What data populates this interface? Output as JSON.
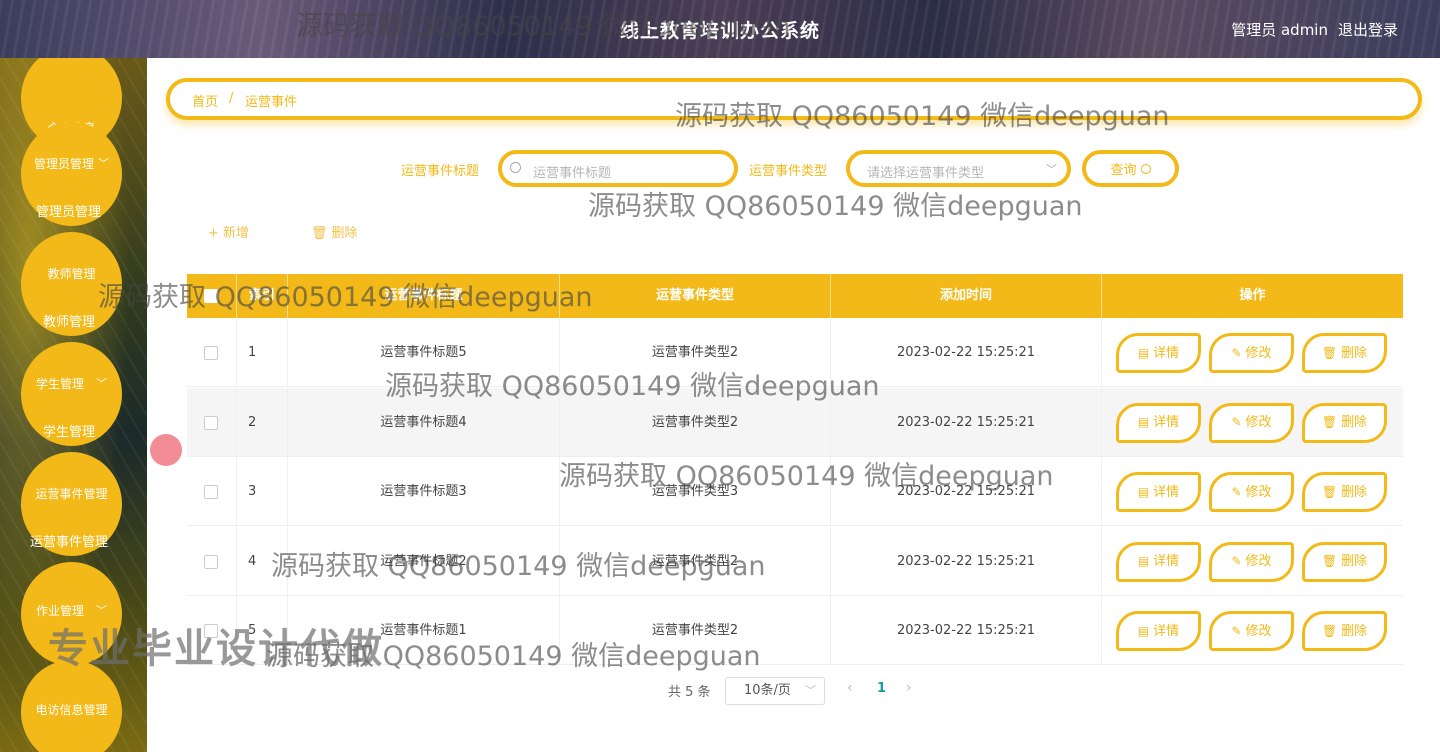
{
  "app": {
    "title": "线上教育培训办公系统"
  },
  "header": {
    "user": "管理员 admin",
    "logout": "退出登录"
  },
  "sidebar": {
    "items": [
      {
        "label": "个人信息",
        "sub": ""
      },
      {
        "label": "管理员管理",
        "sub": "管理员管理"
      },
      {
        "label": "教师管理",
        "sub": "教师管理"
      },
      {
        "label": "学生管理",
        "sub": "学生管理"
      },
      {
        "label": "运营事件管理",
        "sub": "运营事件管理"
      },
      {
        "label": "作业管理",
        "sub": ""
      },
      {
        "label": "电访信息管理",
        "sub": ""
      }
    ]
  },
  "breadcrumb": {
    "home": "首页",
    "sep": "/",
    "current": "运营事件"
  },
  "search": {
    "title_label": "运营事件标题",
    "title_placeholder": "运营事件标题",
    "type_label": "运营事件类型",
    "type_placeholder": "请选择运营事件类型",
    "query_button": "查询"
  },
  "toolbar": {
    "add": "新增",
    "delete": "删除"
  },
  "table": {
    "columns": [
      "索引",
      "运营事件标题",
      "运营事件类型",
      "添加时间",
      "操作"
    ],
    "rows": [
      {
        "index": "1",
        "title": "运营事件标题5",
        "type": "运营事件类型2",
        "time": "2023-02-22 15:25:21"
      },
      {
        "index": "2",
        "title": "运营事件标题4",
        "type": "运营事件类型2",
        "time": "2023-02-22 15:25:21"
      },
      {
        "index": "3",
        "title": "运营事件标题3",
        "type": "运营事件类型3",
        "time": "2023-02-22 15:25:21"
      },
      {
        "index": "4",
        "title": "运营事件标题2",
        "type": "运营事件类型2",
        "time": "2023-02-22 15:25:21"
      },
      {
        "index": "5",
        "title": "运营事件标题1",
        "type": "运营事件类型2",
        "time": "2023-02-22 15:25:21"
      }
    ],
    "actions": {
      "detail": "详情",
      "edit": "修改",
      "delete": "删除"
    }
  },
  "pagination": {
    "total": "共 5 条",
    "page_size": "10条/页",
    "current_page": "1"
  },
  "watermark": {
    "text": "源码获取 QQ86050149 微信deepguan",
    "big": "专业毕业设计代做"
  },
  "colors": {
    "accent": "#f2b918",
    "page": "#1a9a9a"
  }
}
